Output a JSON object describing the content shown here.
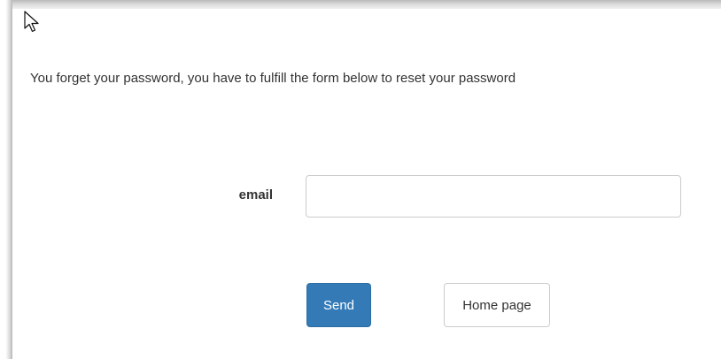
{
  "form": {
    "instructions": "You forget your password, you have to fulfill the form below to reset your password",
    "email_label": "email",
    "email_value": "",
    "email_placeholder": ""
  },
  "buttons": {
    "send_label": "Send",
    "home_label": "Home page"
  },
  "colors": {
    "primary": "#337ab7",
    "text": "#333333",
    "border": "#cccccc"
  },
  "icons": {
    "cursor": "mouse-pointer-icon"
  }
}
